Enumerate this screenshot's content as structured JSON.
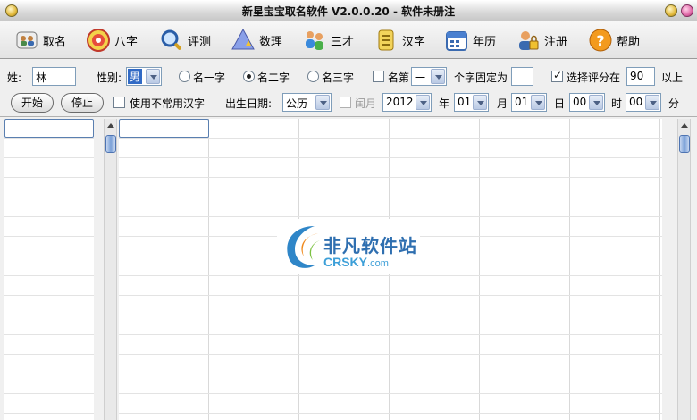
{
  "window": {
    "title": "新星宝宝取名软件 V2.0.0.20 - 软件未册注"
  },
  "toolbar": {
    "items": [
      {
        "label": "取名",
        "icon": "contacts-icon"
      },
      {
        "label": "八字",
        "icon": "eight-char-icon"
      },
      {
        "label": "评测",
        "icon": "magnifier-icon"
      },
      {
        "label": "数理",
        "icon": "shapes-icon"
      },
      {
        "label": "三才",
        "icon": "people-icon"
      },
      {
        "label": "汉字",
        "icon": "scroll-icon"
      },
      {
        "label": "年历",
        "icon": "calendar-icon"
      },
      {
        "label": "注册",
        "icon": "lock-user-icon"
      },
      {
        "label": "帮助",
        "icon": "help-icon"
      }
    ]
  },
  "form": {
    "surname_label": "姓:",
    "surname_value": "林",
    "gender_label": "性别:",
    "gender_value": "男",
    "radio_one_char": "名一字",
    "radio_two_char": "名二字",
    "radio_three_char": "名三字",
    "name_pos_label": "名第",
    "name_pos_value": "一",
    "fixed_char_label": "个字固定为",
    "fixed_char_value": "",
    "score_label": "选择评分在",
    "score_value": "90",
    "score_suffix": "以上",
    "start_label": "开始",
    "stop_label": "停止",
    "rare_char_label": "使用不常用汉字",
    "birth_label": "出生日期:",
    "calendar_value": "公历",
    "leap_month_label": "闰月",
    "year_value": "2012",
    "year_label": "年",
    "month_value": "01",
    "month_label": "月",
    "day_value": "01",
    "day_label": "日",
    "hour_value": "00",
    "hour_label": "时",
    "minute_value": "00",
    "minute_label": "分"
  },
  "colors": {
    "accent": "#316ac5",
    "input_border": "#7f9db9"
  },
  "watermark": {
    "cn": "非凡软件站",
    "en_main": "CRSKY",
    "en_suffix": ".com"
  }
}
